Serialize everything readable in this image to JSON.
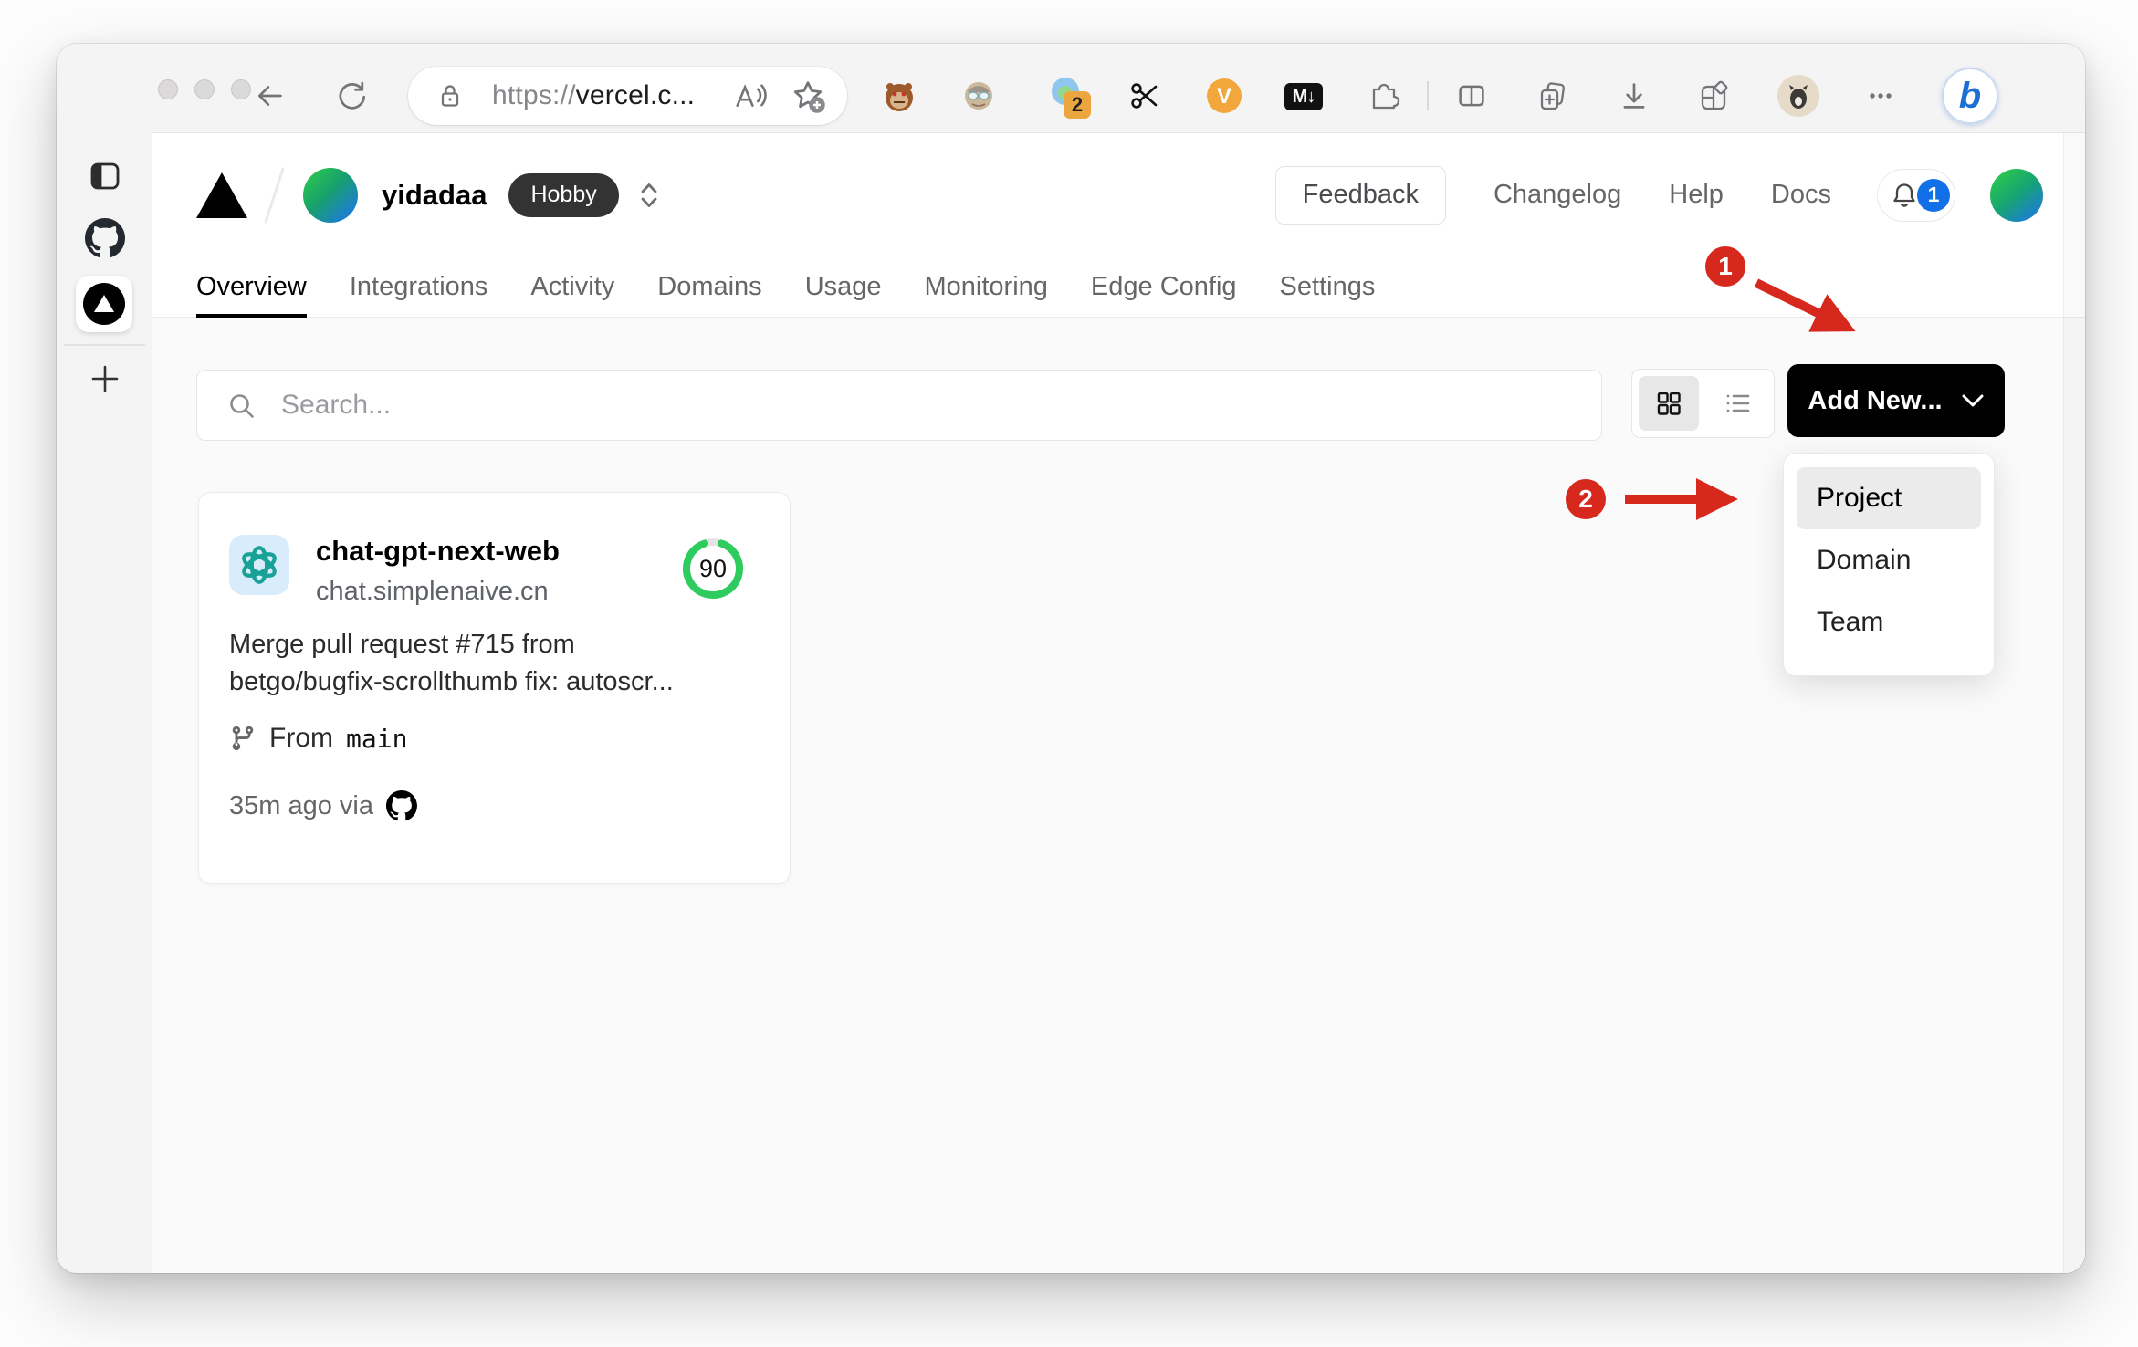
{
  "browser": {
    "url_protocol": "https://",
    "url_host": "vercel.c...",
    "extension_badge_count": "2",
    "markdown_ext_label": "M↓",
    "v_ext_label": "V",
    "bing_label": "b"
  },
  "vercel_header": {
    "team_name": "yidadaa",
    "plan_badge": "Hobby",
    "feedback_label": "Feedback",
    "changelog_label": "Changelog",
    "help_label": "Help",
    "docs_label": "Docs",
    "notification_count": "1"
  },
  "tabs": [
    {
      "label": "Overview",
      "active": true
    },
    {
      "label": "Integrations",
      "active": false
    },
    {
      "label": "Activity",
      "active": false
    },
    {
      "label": "Domains",
      "active": false
    },
    {
      "label": "Usage",
      "active": false
    },
    {
      "label": "Monitoring",
      "active": false
    },
    {
      "label": "Edge Config",
      "active": false
    },
    {
      "label": "Settings",
      "active": false
    }
  ],
  "toolbar": {
    "search_placeholder": "Search...",
    "add_new_label": "Add New..."
  },
  "add_new_menu": {
    "items": [
      "Project",
      "Domain",
      "Team"
    ],
    "highlighted": "Project"
  },
  "project_card": {
    "name": "chat-gpt-next-web",
    "domain": "chat.simplenaive.cn",
    "score": "90",
    "commit_message_line1": "Merge pull request #715 from",
    "commit_message_line2": "betgo/bugfix-scrollthumb fix: autoscr...",
    "branch_prefix": "From",
    "branch_name": "main",
    "deploy_time": "35m ago via"
  },
  "annotations": {
    "step_1": "1",
    "step_2": "2"
  },
  "colors": {
    "annotation_red": "#d7281d",
    "score_ring_green": "#2ecc5f",
    "notification_blue": "#1170e8",
    "add_new_black": "#000000",
    "content_background": "#fafafa"
  }
}
